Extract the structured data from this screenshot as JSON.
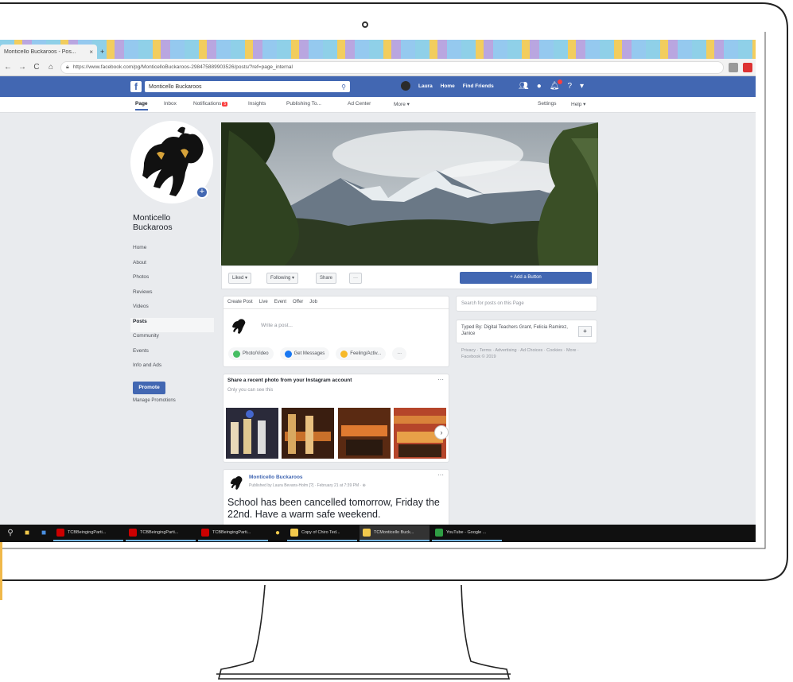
{
  "browser": {
    "tab_title": "Monticello Buckaroos - Pos...",
    "tab_close": "×",
    "new_tab": "+",
    "url": "https://www.facebook.com/pg/MonticelloBuckaroos-298475889903526/posts/?ref=page_internal",
    "nav_back": "←",
    "nav_forward": "→",
    "nav_reload": "C",
    "nav_home": "⌂"
  },
  "fb_header": {
    "logo": "f",
    "search_value": "Monticello Buckaroos",
    "search_icon": "⚲",
    "user_name": "Laura",
    "home": "Home",
    "find_friends": "Find Friends"
  },
  "page_tabs": {
    "page": "Page",
    "inbox": "Inbox",
    "notifications": "Notifications",
    "notifications_count": "5",
    "insights": "Insights",
    "publishing_tools": "Publishing To...",
    "ad_center": "Ad Center",
    "more": "More ▾",
    "settings": "Settings",
    "help": "Help ▾"
  },
  "page": {
    "name_line1": "Monticello",
    "name_line2": "Buckaroos",
    "left_nav": [
      "Home",
      "About",
      "Photos",
      "Reviews",
      "Videos",
      "Posts",
      "Community",
      "Events",
      "Info and Ads"
    ],
    "promote": "Promote",
    "manage_promotions": "Manage Promotions"
  },
  "cover_actions": {
    "liked": "Liked ▾",
    "following": "Following ▾",
    "share": "Share",
    "more": "···",
    "add_button": "+ Add a Button"
  },
  "composer": {
    "tabs": [
      "Create Post",
      "Live",
      "Event",
      "Offer",
      "Job"
    ],
    "placeholder": "Write a post...",
    "photo_video": "Photo/Video",
    "get_messages": "Get Messages",
    "feeling": "Feeling/Activ...",
    "more": "···"
  },
  "instagram_card": {
    "title": "Share a recent photo from your Instagram account",
    "subtitle": "Only you can see this",
    "more": "···",
    "next": "›"
  },
  "post": {
    "author": "Monticello Buckaroos",
    "meta": "Published by Laura Bevans-Holm [?] · February 21 at 7:39 PM · ⊕",
    "text": "School has been cancelled tomorrow, Friday the 22nd. Have a warm safe weekend.",
    "more": "···"
  },
  "right_column": {
    "search_placeholder": "Search for posts on this Page",
    "typed_text": "Typed By: Digital Teachers Grant, Felicia Ramirez, Janice",
    "plus": "+",
    "footer": "Privacy · Terms · Advertising · Ad Choices · Cookies · More · Facebook © 2019"
  },
  "taskbar": {
    "items": [
      "TCBBeingingParti...",
      "TCBBeingingParti...",
      "TCBBeingingParti...",
      "Copy of Chiro Ted...",
      "TCMonticello Buck...",
      "YouTube - Google ..."
    ]
  },
  "colors": {
    "fb_blue": "#4267b2",
    "page_bg": "#e9ebee",
    "notif_red": "#fa3e3e",
    "taskbar": "#101010"
  }
}
